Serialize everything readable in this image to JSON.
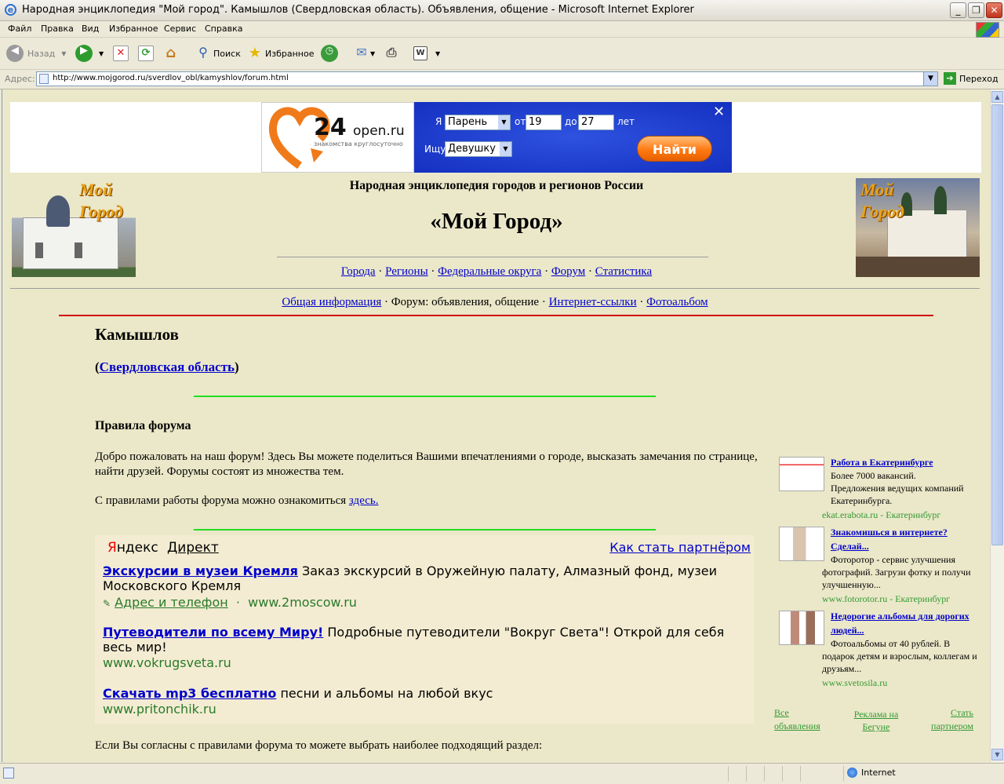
{
  "window": {
    "title": "Народная энциклопедия \"Мой город\". Камышлов (Свердловская область). Объявления, общение - Microsoft Internet Explorer"
  },
  "menu": [
    "Файл",
    "Правка",
    "Вид",
    "Избранное",
    "Сервис",
    "Справка"
  ],
  "toolbar": {
    "back": "Назад",
    "search": "Поиск",
    "favorites": "Избранное"
  },
  "address": {
    "label": "Адрес:",
    "url": "http://www.mojgorod.ru/sverdlov_obl/kamyshlov/forum.html",
    "go": "Переход"
  },
  "banner": {
    "logo_num": "24",
    "logo_domain": "open.ru",
    "logo_tagline": "знакомства круглосуточно",
    "i_label": "Я",
    "i_value": "Парень",
    "from_label": "от",
    "from_value": "19",
    "to_label": "до",
    "to_value": "27",
    "years_label": "лет",
    "seek_label": "Ищу",
    "seek_value": "Девушку",
    "button": "Найти"
  },
  "header": {
    "subtitle": "Народная энциклопедия городов и регионов России",
    "title": "«Мой Город»",
    "logo_text_1": "Мой",
    "logo_text_2": "Город",
    "nav": [
      "Города",
      "Регионы",
      "Федеральные округа",
      "Форум",
      "Статистика"
    ],
    "subnav": {
      "link1": "Общая информация",
      "current": "Форум: объявления, общение",
      "link2": "Интернет-ссылки",
      "link3": "Фотоальбом"
    }
  },
  "content": {
    "city": "Камышлов",
    "region": "Свердловская область",
    "rules_title": "Правила форума",
    "welcome": "Добро пожаловать на наш форум! Здесь Вы можете поделиться Вашими впечатлениями о городе, высказать замечания по странице, найти друзей. Форумы состоят из множества тем.",
    "rules_text": "С правилами работы форума можно ознакомиться",
    "rules_link": "здесь.",
    "agree_text": "Если Вы согласны с правилами форума то можете выбрать наиболее подходящий раздел:"
  },
  "yandex": {
    "brand_y": "Я",
    "brand_rest": "ндекс",
    "direct": "Директ",
    "partner": "Как стать партнёром",
    "ads": [
      {
        "title": "Экскурсии в музеи Кремля",
        "text": "Заказ экскурсий в Оружейную палату, Алмазный фонд, музеи Московского Кремля",
        "extra": "Адрес и телефон",
        "url": "www.2moscow.ru"
      },
      {
        "title": "Путеводители по всему Миру!",
        "text": "Подробные путеводители \"Вокруг Света\"! Открой для себя весь мир!",
        "url": "www.vokrugsveta.ru"
      },
      {
        "title": "Скачать mp3 бесплатно",
        "text": "песни и альбомы на любой вкус",
        "url": "www.pritonchik.ru"
      }
    ]
  },
  "side_ads": [
    {
      "title": "Работа в Екатеринбурге",
      "text": "Более 7000 вакансий. Предложения ведущих компаний Екатеринбурга.",
      "url": "ekat.erabota.ru - Екатеринбург"
    },
    {
      "title": "Знакомишься в интернете? Сделай...",
      "text": "Фоторотор - сервис улучшения фотографий. Загрузи фотку и получи улучшенную...",
      "url": "www.fotorotor.ru - Екатеринбург"
    },
    {
      "title": "Недорогие альбомы для дорогих людей...",
      "text": "Фотоальбомы от 40 рублей. В подарок детям и взрослым, коллегам и друзьям...",
      "url": "www.svetosila.ru"
    }
  ],
  "side_footer": [
    "Все объявления",
    "Реклама на Бегуне",
    "Стать партнером"
  ],
  "status": {
    "zone": "Internet"
  }
}
